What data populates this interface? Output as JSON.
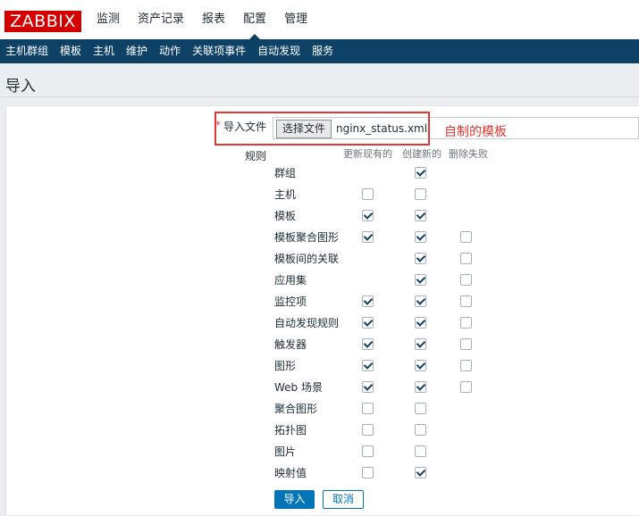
{
  "header": {
    "logo": "ZABBIX",
    "menu": [
      "监测",
      "资产记录",
      "报表",
      "配置",
      "管理"
    ],
    "selected": "配置"
  },
  "submenu": [
    "主机群组",
    "模板",
    "主机",
    "维护",
    "动作",
    "关联项事件",
    "自动发现",
    "服务"
  ],
  "page": {
    "title": "导入"
  },
  "form": {
    "required_mark": "*",
    "file_label": "导入文件",
    "file_button": "选择文件",
    "file_name": "nginx_status.xml",
    "annotation": "自制的模板",
    "rules_label": "规则",
    "columns": [
      "更新现有的",
      "创建新的",
      "删除失败"
    ],
    "rules": [
      {
        "name": "群组",
        "update": null,
        "create": true,
        "delete": null
      },
      {
        "name": "主机",
        "update": false,
        "create": false,
        "delete": null
      },
      {
        "name": "模板",
        "update": true,
        "create": true,
        "delete": null
      },
      {
        "name": "模板聚合图形",
        "update": true,
        "create": true,
        "delete": false
      },
      {
        "name": "模板间的关联",
        "update": null,
        "create": true,
        "delete": false
      },
      {
        "name": "应用集",
        "update": null,
        "create": true,
        "delete": false
      },
      {
        "name": "监控项",
        "update": true,
        "create": true,
        "delete": false
      },
      {
        "name": "自动发现规则",
        "update": true,
        "create": true,
        "delete": false
      },
      {
        "name": "触发器",
        "update": true,
        "create": true,
        "delete": false
      },
      {
        "name": "图形",
        "update": true,
        "create": true,
        "delete": false
      },
      {
        "name": "Web 场景",
        "update": true,
        "create": true,
        "delete": false
      },
      {
        "name": "聚合图形",
        "update": false,
        "create": false,
        "delete": null
      },
      {
        "name": "拓扑图",
        "update": false,
        "create": false,
        "delete": null
      },
      {
        "name": "图片",
        "update": false,
        "create": false,
        "delete": null
      },
      {
        "name": "映射值",
        "update": false,
        "create": true,
        "delete": null
      }
    ],
    "import_button": "导入",
    "cancel_button": "取消"
  }
}
